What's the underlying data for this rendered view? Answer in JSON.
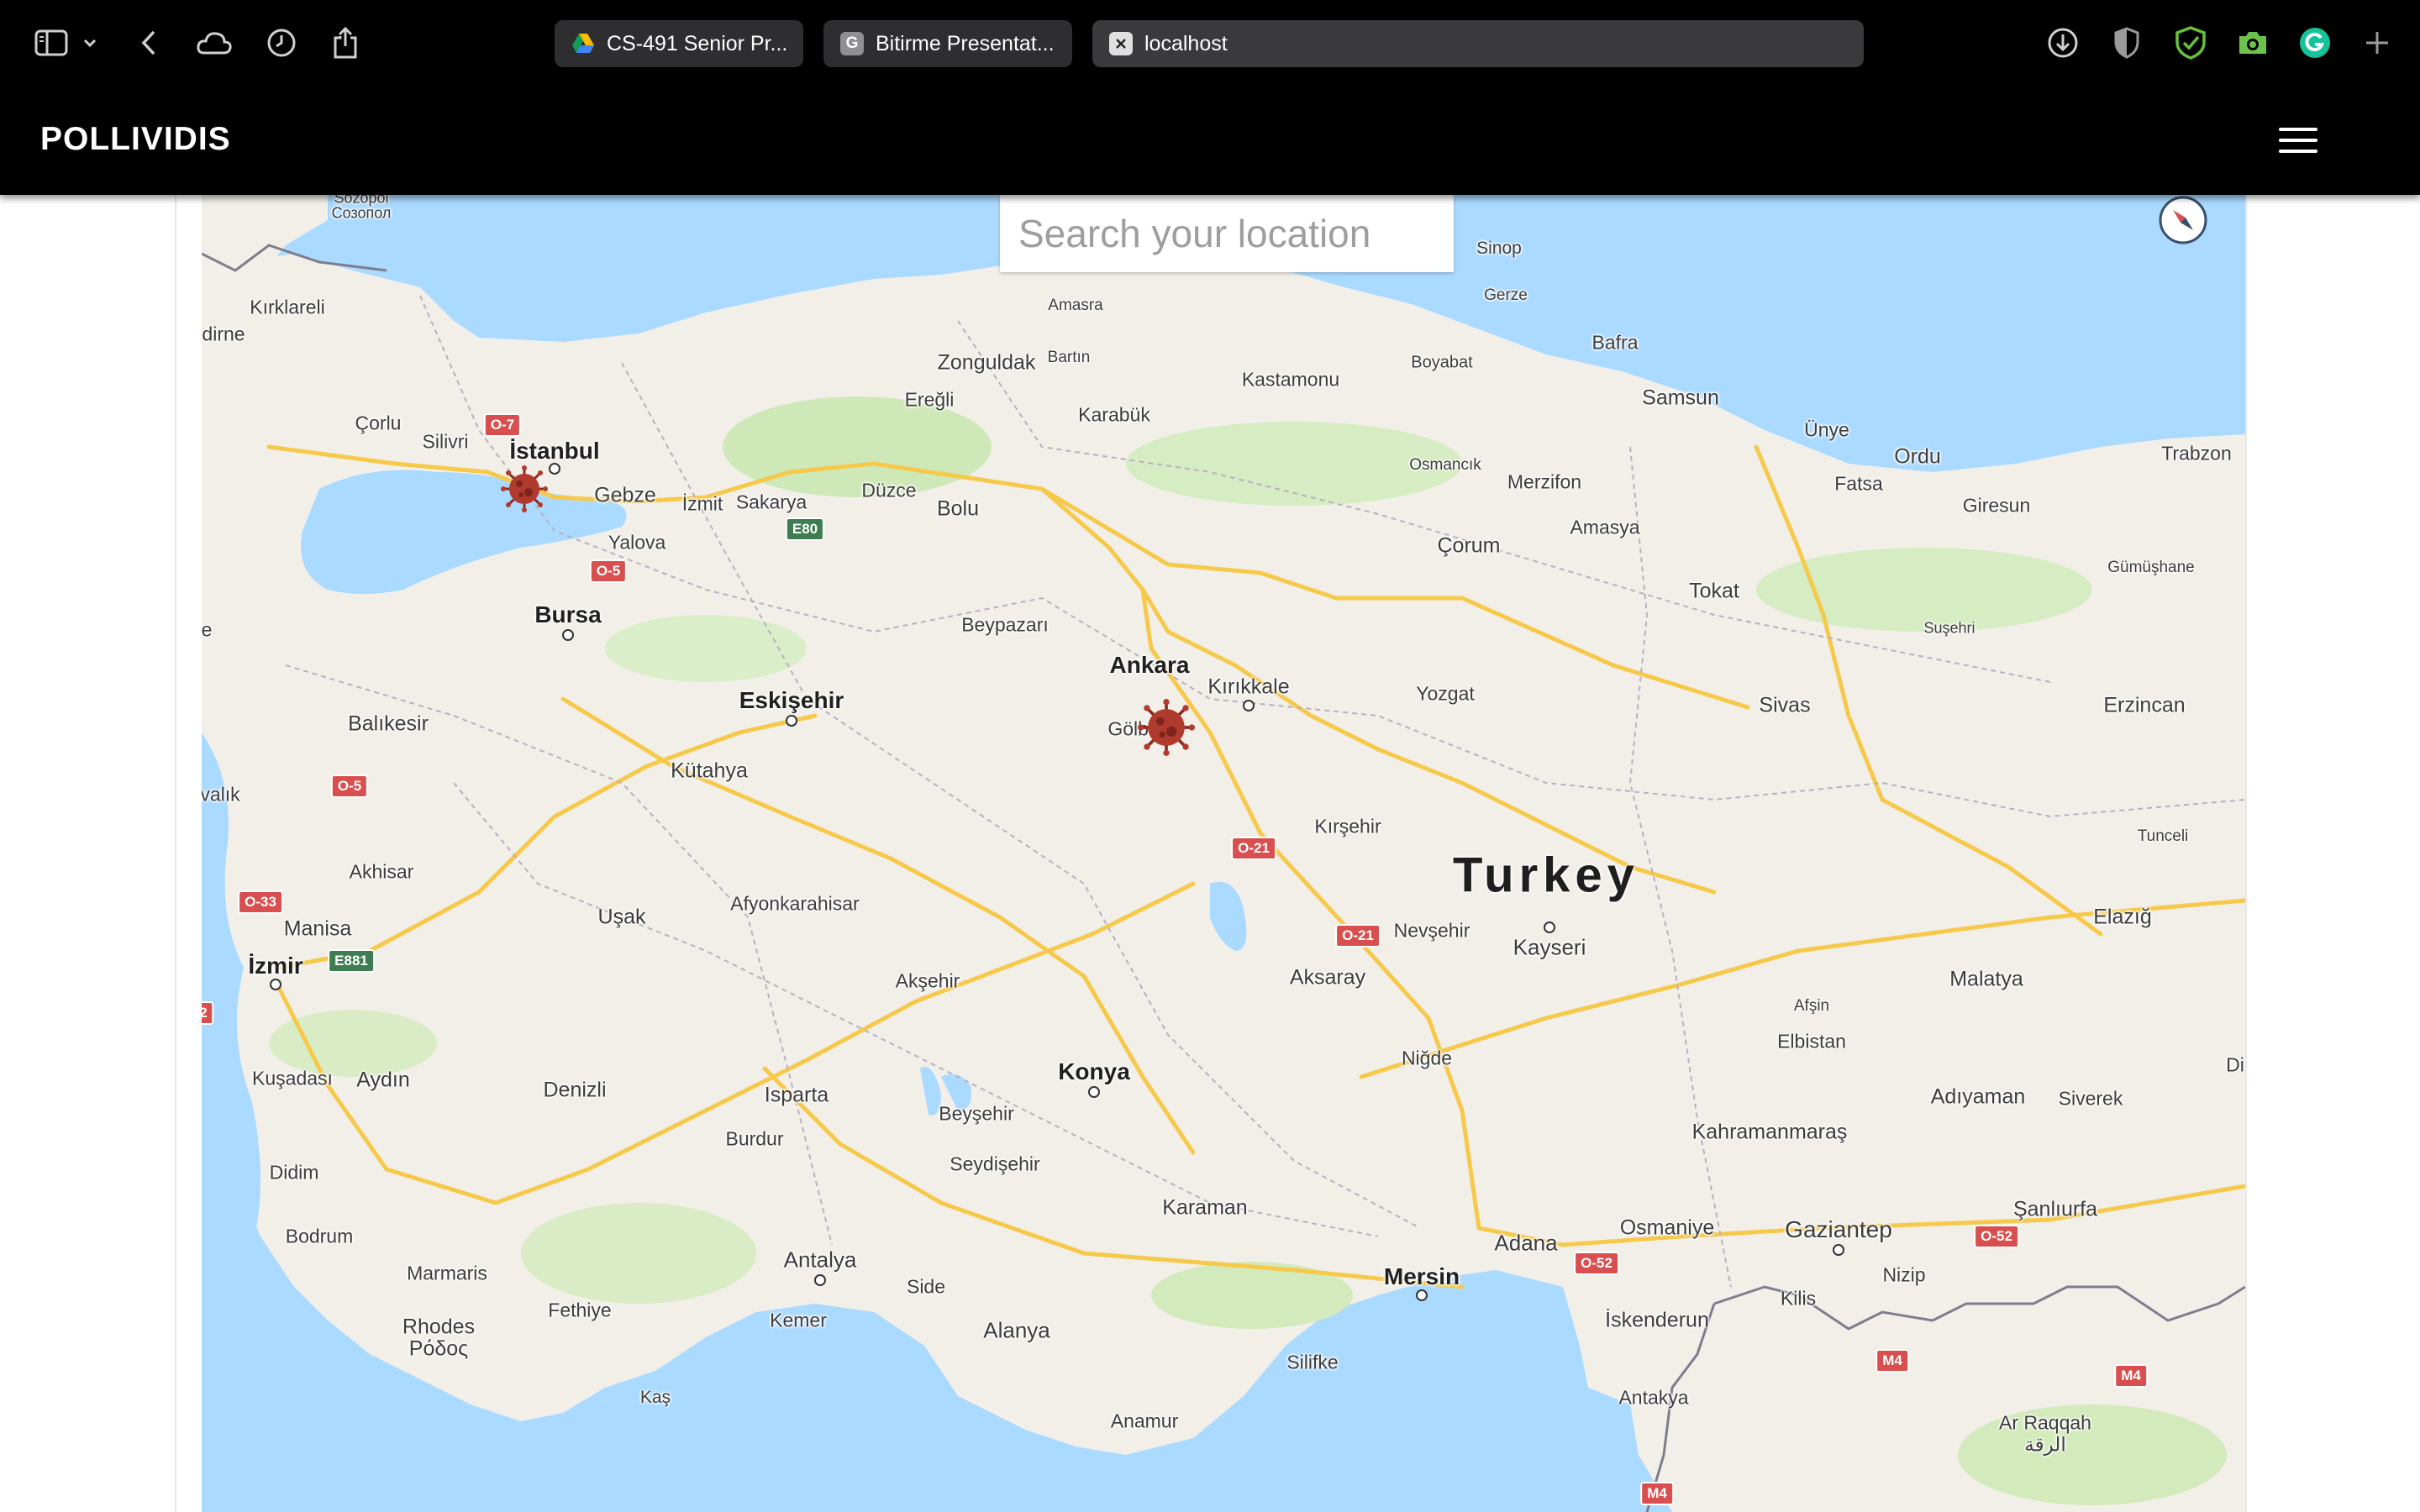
{
  "browser": {
    "tabs": [
      {
        "label": "CS-491 Senior Pr...",
        "favicon": "google-drive-icon",
        "active": false
      },
      {
        "label": "Bitirme Presentat...",
        "favicon": "G",
        "active": false
      },
      {
        "label": "localhost",
        "favicon": "close-icon",
        "active": true
      }
    ]
  },
  "app": {
    "brand": "POLLIVIDIS"
  },
  "map": {
    "search_placeholder": "Search your location",
    "country_label": "Turkey",
    "cities": [
      {
        "name": "Sozopol",
        "style": "small"
      },
      {
        "name": "Созопол",
        "style": "small"
      },
      {
        "name": "Kırklareli",
        "style": "normal"
      },
      {
        "name": "dirne",
        "style": "normal"
      },
      {
        "name": "Çorlu",
        "style": "normal"
      },
      {
        "name": "Silivri",
        "style": "normal"
      },
      {
        "name": "İstanbul",
        "style": "big"
      },
      {
        "name": "Gebze",
        "style": "normal"
      },
      {
        "name": "İzmit",
        "style": "normal"
      },
      {
        "name": "Sakarya",
        "style": "normal"
      },
      {
        "name": "Yalova",
        "style": "normal"
      },
      {
        "name": "Düzce",
        "style": "normal"
      },
      {
        "name": "Bolu",
        "style": "normal"
      },
      {
        "name": "Zonguldak",
        "style": "normal"
      },
      {
        "name": "Ereğli",
        "style": "normal"
      },
      {
        "name": "Amasra",
        "style": "small"
      },
      {
        "name": "Bartın",
        "style": "small"
      },
      {
        "name": "Karabük",
        "style": "normal"
      },
      {
        "name": "Kastamonu",
        "style": "normal"
      },
      {
        "name": "Sinop",
        "style": "normal"
      },
      {
        "name": "Gerze",
        "style": "small"
      },
      {
        "name": "Boyabat",
        "style": "small"
      },
      {
        "name": "Bafra",
        "style": "normal"
      },
      {
        "name": "Samsun",
        "style": "normal"
      },
      {
        "name": "Ünye",
        "style": "normal"
      },
      {
        "name": "Ordu",
        "style": "normal"
      },
      {
        "name": "Fatsa",
        "style": "normal"
      },
      {
        "name": "Giresun",
        "style": "normal"
      },
      {
        "name": "Trabzon",
        "style": "normal"
      },
      {
        "name": "Gümüşhane",
        "style": "small"
      },
      {
        "name": "Osmancık",
        "style": "small"
      },
      {
        "name": "Merzifon",
        "style": "normal"
      },
      {
        "name": "Amasya",
        "style": "normal"
      },
      {
        "name": "Çorum",
        "style": "normal"
      },
      {
        "name": "Tokat",
        "style": "normal"
      },
      {
        "name": "Suşehri",
        "style": "small"
      },
      {
        "name": "Bursa",
        "style": "big"
      },
      {
        "name": "Beypazarı",
        "style": "normal"
      },
      {
        "name": "Ankara",
        "style": "big"
      },
      {
        "name": "Gölbaşı",
        "style": "normal"
      },
      {
        "name": "Kırıkkale",
        "style": "normal"
      },
      {
        "name": "Yozgat",
        "style": "normal"
      },
      {
        "name": "Sivas",
        "style": "normal"
      },
      {
        "name": "Erzincan",
        "style": "normal"
      },
      {
        "name": "Balıkesir",
        "style": "normal"
      },
      {
        "name": "Eskişehir",
        "style": "big"
      },
      {
        "name": "Kütahya",
        "style": "normal"
      },
      {
        "name": "valık",
        "style": "normal"
      },
      {
        "name": "Akhisar",
        "style": "normal"
      },
      {
        "name": "Manisa",
        "style": "normal"
      },
      {
        "name": "İzmir",
        "style": "big"
      },
      {
        "name": "Uşak",
        "style": "normal"
      },
      {
        "name": "Afyonkarahisar",
        "style": "normal"
      },
      {
        "name": "Akşehir",
        "style": "normal"
      },
      {
        "name": "Kırşehir",
        "style": "normal"
      },
      {
        "name": "Turkey",
        "style": "country"
      },
      {
        "name": "Nevşehir",
        "style": "normal"
      },
      {
        "name": "Kayseri",
        "style": "normal"
      },
      {
        "name": "Aksaray",
        "style": "normal"
      },
      {
        "name": "Tunceli",
        "style": "small"
      },
      {
        "name": "Elazığ",
        "style": "normal"
      },
      {
        "name": "Malatya",
        "style": "normal"
      },
      {
        "name": "Afşin",
        "style": "small"
      },
      {
        "name": "Elbistan",
        "style": "normal"
      },
      {
        "name": "Niğde",
        "style": "normal"
      },
      {
        "name": "Kuşadası",
        "style": "normal"
      },
      {
        "name": "Aydın",
        "style": "normal"
      },
      {
        "name": "Denizli",
        "style": "normal"
      },
      {
        "name": "Isparta",
        "style": "normal"
      },
      {
        "name": "Burdur",
        "style": "normal"
      },
      {
        "name": "Beyşehir",
        "style": "normal"
      },
      {
        "name": "Seydişehir",
        "style": "normal"
      },
      {
        "name": "Konya",
        "style": "big"
      },
      {
        "name": "Karaman",
        "style": "normal"
      },
      {
        "name": "Adıyaman",
        "style": "normal"
      },
      {
        "name": "Siverek",
        "style": "normal"
      },
      {
        "name": "Kahramanmaraş",
        "style": "normal"
      },
      {
        "name": "Didim",
        "style": "normal"
      },
      {
        "name": "Bodrum",
        "style": "normal"
      },
      {
        "name": "Marmaris",
        "style": "normal"
      },
      {
        "name": "Fethiye",
        "style": "normal"
      },
      {
        "name": "Rhodes",
        "style": "normal"
      },
      {
        "name": "Ρόδος",
        "style": "normal"
      },
      {
        "name": "Antalya",
        "style": "normal"
      },
      {
        "name": "Side",
        "style": "normal"
      },
      {
        "name": "Kemer",
        "style": "normal"
      },
      {
        "name": "Alanya",
        "style": "normal"
      },
      {
        "name": "Mersin",
        "style": "big"
      },
      {
        "name": "Adana",
        "style": "normal"
      },
      {
        "name": "Osmaniye",
        "style": "normal"
      },
      {
        "name": "Gaziantep",
        "style": "normal"
      },
      {
        "name": "Şanlıurfa",
        "style": "normal"
      },
      {
        "name": "Nizip",
        "style": "normal"
      },
      {
        "name": "Kilis",
        "style": "normal"
      },
      {
        "name": "İskenderun",
        "style": "normal"
      },
      {
        "name": "Antakya",
        "style": "normal"
      },
      {
        "name": "Silifke",
        "style": "normal"
      },
      {
        "name": "Anamur",
        "style": "normal"
      },
      {
        "name": "Kaş",
        "style": "normal"
      },
      {
        "name": "Ar Raqqah",
        "style": "normal"
      },
      {
        "name": "الرقة",
        "style": "normal"
      },
      {
        "name": "e",
        "style": "normal"
      },
      {
        "name": "Di",
        "style": "normal"
      }
    ],
    "road_shields": [
      {
        "label": "O-7",
        "color": "red"
      },
      {
        "label": "E80",
        "color": "green"
      },
      {
        "label": "O-5",
        "color": "red"
      },
      {
        "label": "O-5",
        "color": "red"
      },
      {
        "label": "O-33",
        "color": "red"
      },
      {
        "label": "E881",
        "color": "green"
      },
      {
        "label": "O-21",
        "color": "red"
      },
      {
        "label": "O-21",
        "color": "red"
      },
      {
        "label": "O-52",
        "color": "red"
      },
      {
        "label": "O-52",
        "color": "red"
      },
      {
        "label": "M4",
        "color": "red"
      },
      {
        "label": "M4",
        "color": "red"
      },
      {
        "label": "M4",
        "color": "red"
      },
      {
        "label": "2",
        "color": "red"
      }
    ],
    "markers": [
      {
        "name": "virus-marker-istanbul",
        "near": "İstanbul"
      },
      {
        "name": "virus-marker-ankara",
        "near": "Ankara"
      }
    ],
    "colors": {
      "sea": "#aadaff",
      "land": "#f2efe9",
      "vegetation": "#c8e6b4",
      "highway": "#f6c94a",
      "virus": "#b13a2e"
    }
  }
}
